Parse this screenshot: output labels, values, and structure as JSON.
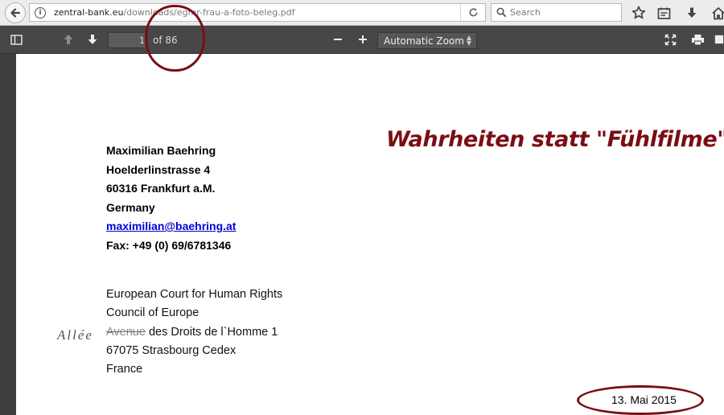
{
  "browser": {
    "url_domain": "zentral-bank.eu",
    "url_path": "/downloads/egmr-frau-a-foto-beleg.pdf",
    "search_placeholder": "Search",
    "toolbar_icons": [
      "star-icon",
      "reading-list-icon",
      "download-icon",
      "home-icon"
    ]
  },
  "pdf_toolbar": {
    "current_page": "1",
    "page_of": "of 86",
    "zoom_label": "Automatic Zoom"
  },
  "document": {
    "headline": "Wahrheiten statt \"Fühlfilme\"",
    "sender": {
      "name": "Maximilian Baehring",
      "street": "Hoelderlinstrasse 4",
      "city": "60316 Frankfurt a.M.",
      "country": "Germany",
      "email": "maximilian@baehring.at",
      "fax": "Fax: +49 (0) 69/6781346"
    },
    "recipient": {
      "line1": "European Court for Human Rights",
      "line2": "Council of Europe",
      "street_struck": "Avenue",
      "street_rest": " des Droits de l`Homme 1",
      "city": "67075 Strasbourg Cedex",
      "country": "France"
    },
    "handwritten_correction": "Allée",
    "date": "13. Mai 2015"
  },
  "colors": {
    "headline": "#7b0e13",
    "annotation_circle": "#7a0f14",
    "link": "#0000d6",
    "pdf_toolbar": "#474747"
  }
}
